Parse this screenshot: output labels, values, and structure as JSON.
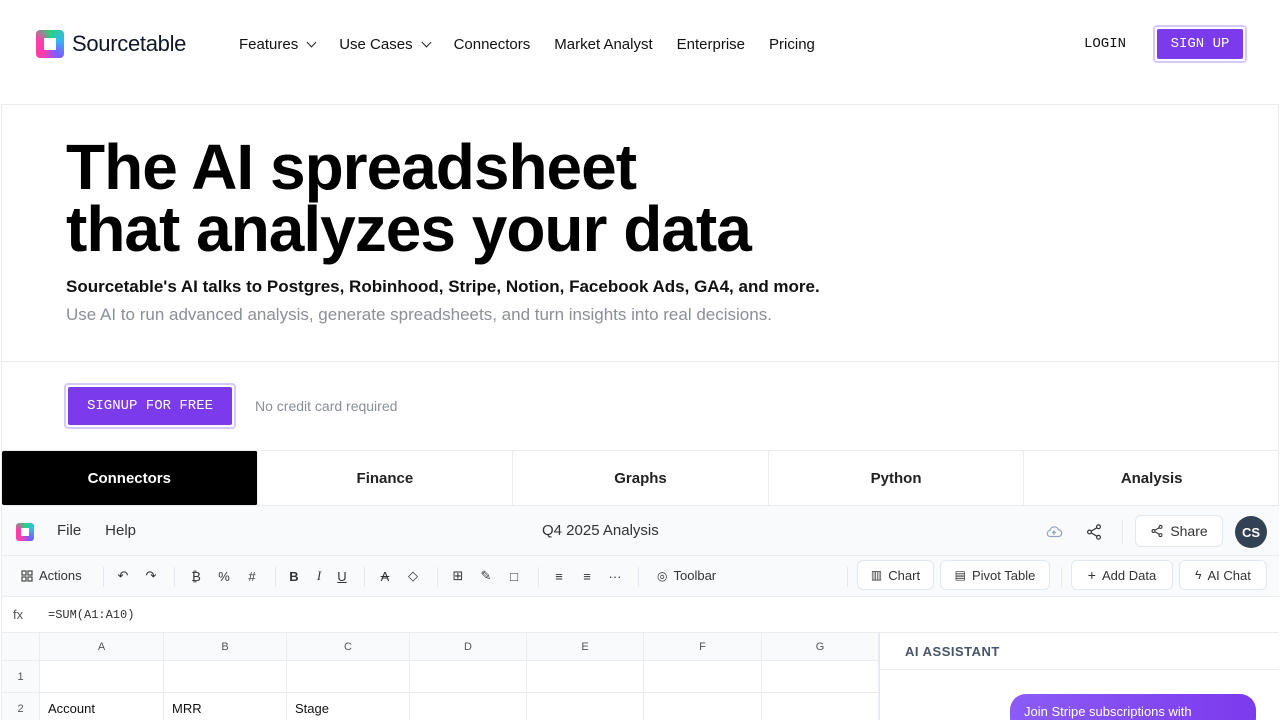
{
  "nav": {
    "brand": "Sourcetable",
    "items": [
      {
        "label": "Features",
        "dropdown": true
      },
      {
        "label": "Use Cases",
        "dropdown": true
      },
      {
        "label": "Connectors",
        "dropdown": false
      },
      {
        "label": "Market Analyst",
        "dropdown": false
      },
      {
        "label": "Enterprise",
        "dropdown": false
      },
      {
        "label": "Pricing",
        "dropdown": false
      }
    ],
    "login": "LOGIN",
    "signup": "SIGN UP"
  },
  "hero": {
    "headline_line1": "The AI spreadsheet",
    "headline_line2": "that analyzes your data",
    "subhead": "Sourcetable's AI talks to Postgres, Robinhood, Stripe, Notion, Facebook Ads, GA4, and more.",
    "description": "Use AI to run advanced analysis, generate spreadsheets, and turn insights into real decisions.",
    "cta": "SIGNUP FOR FREE",
    "cta_note": "No credit card required"
  },
  "tabs": [
    {
      "label": "Connectors",
      "active": true
    },
    {
      "label": "Finance",
      "active": false
    },
    {
      "label": "Graphs",
      "active": false
    },
    {
      "label": "Python",
      "active": false
    },
    {
      "label": "Analysis",
      "active": false
    }
  ],
  "app": {
    "menu": [
      "File",
      "Help"
    ],
    "doc_title": "Q4 2025 Analysis",
    "share_label": "Share",
    "avatar_initials": "CS",
    "toolbar": {
      "actions_label": "Actions",
      "toolbar_label": "Toolbar",
      "chart_label": "Chart",
      "pivot_label": "Pivot Table",
      "add_data_label": "Add Data",
      "ai_chat_label": "AI Chat"
    },
    "formula": {
      "fx": "fx",
      "expression": "=SUM(A1:A10)"
    },
    "grid": {
      "columns": [
        "A",
        "B",
        "C",
        "D",
        "E",
        "F",
        "G"
      ],
      "rows": [
        {
          "num": "1",
          "cells": [
            "",
            "",
            "",
            "",
            "",
            "",
            ""
          ]
        },
        {
          "num": "2",
          "cells": [
            "Account",
            "MRR",
            "Stage",
            "",
            "",
            "",
            ""
          ]
        }
      ]
    },
    "ai_panel": {
      "title": "AI ASSISTANT",
      "bubble": "Join Stripe subscriptions with"
    }
  },
  "colors": {
    "accent": "#7c3aed",
    "active_tab": "#000000"
  }
}
